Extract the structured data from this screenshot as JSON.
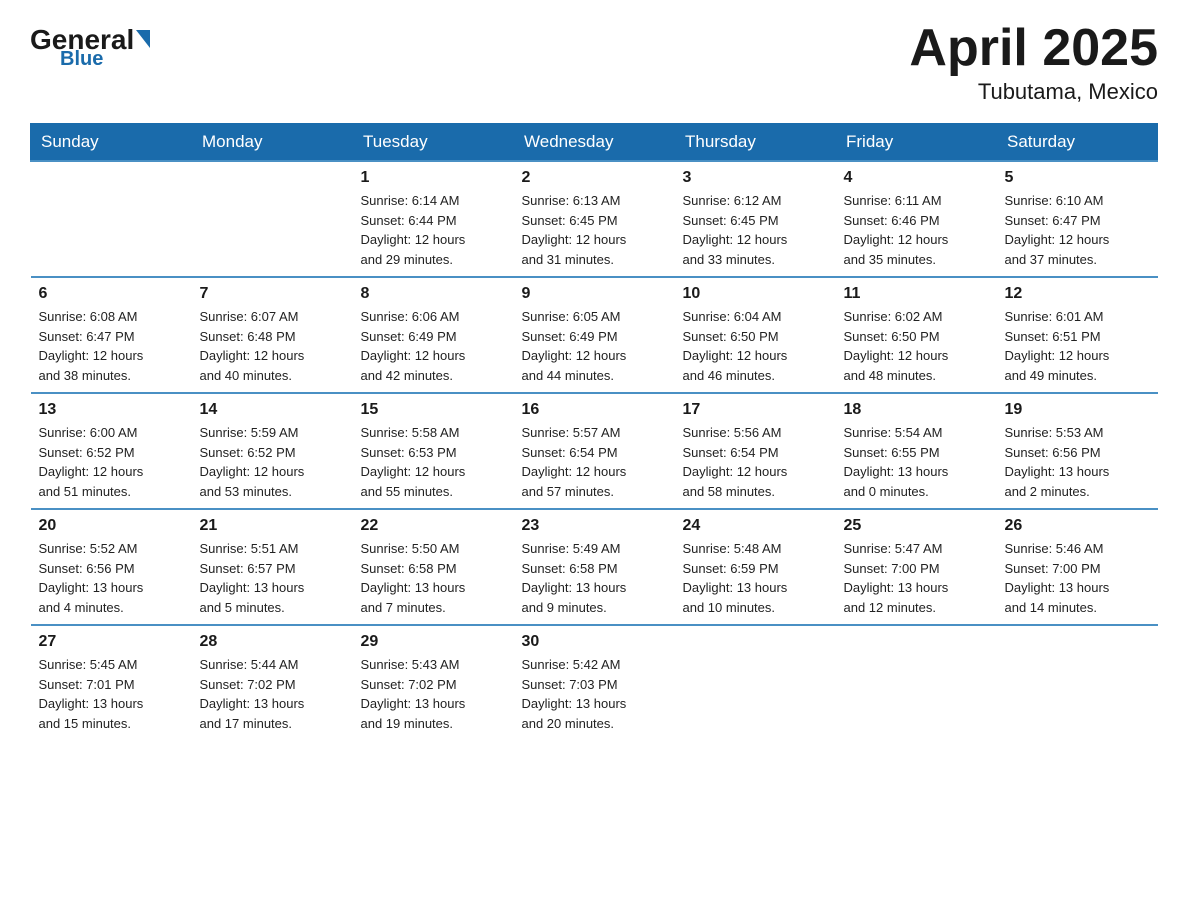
{
  "header": {
    "logo_general": "General",
    "logo_blue": "Blue",
    "month_year": "April 2025",
    "location": "Tubutama, Mexico"
  },
  "days_of_week": [
    "Sunday",
    "Monday",
    "Tuesday",
    "Wednesday",
    "Thursday",
    "Friday",
    "Saturday"
  ],
  "weeks": [
    [
      {
        "day": "",
        "info": ""
      },
      {
        "day": "",
        "info": ""
      },
      {
        "day": "1",
        "info": "Sunrise: 6:14 AM\nSunset: 6:44 PM\nDaylight: 12 hours\nand 29 minutes."
      },
      {
        "day": "2",
        "info": "Sunrise: 6:13 AM\nSunset: 6:45 PM\nDaylight: 12 hours\nand 31 minutes."
      },
      {
        "day": "3",
        "info": "Sunrise: 6:12 AM\nSunset: 6:45 PM\nDaylight: 12 hours\nand 33 minutes."
      },
      {
        "day": "4",
        "info": "Sunrise: 6:11 AM\nSunset: 6:46 PM\nDaylight: 12 hours\nand 35 minutes."
      },
      {
        "day": "5",
        "info": "Sunrise: 6:10 AM\nSunset: 6:47 PM\nDaylight: 12 hours\nand 37 minutes."
      }
    ],
    [
      {
        "day": "6",
        "info": "Sunrise: 6:08 AM\nSunset: 6:47 PM\nDaylight: 12 hours\nand 38 minutes."
      },
      {
        "day": "7",
        "info": "Sunrise: 6:07 AM\nSunset: 6:48 PM\nDaylight: 12 hours\nand 40 minutes."
      },
      {
        "day": "8",
        "info": "Sunrise: 6:06 AM\nSunset: 6:49 PM\nDaylight: 12 hours\nand 42 minutes."
      },
      {
        "day": "9",
        "info": "Sunrise: 6:05 AM\nSunset: 6:49 PM\nDaylight: 12 hours\nand 44 minutes."
      },
      {
        "day": "10",
        "info": "Sunrise: 6:04 AM\nSunset: 6:50 PM\nDaylight: 12 hours\nand 46 minutes."
      },
      {
        "day": "11",
        "info": "Sunrise: 6:02 AM\nSunset: 6:50 PM\nDaylight: 12 hours\nand 48 minutes."
      },
      {
        "day": "12",
        "info": "Sunrise: 6:01 AM\nSunset: 6:51 PM\nDaylight: 12 hours\nand 49 minutes."
      }
    ],
    [
      {
        "day": "13",
        "info": "Sunrise: 6:00 AM\nSunset: 6:52 PM\nDaylight: 12 hours\nand 51 minutes."
      },
      {
        "day": "14",
        "info": "Sunrise: 5:59 AM\nSunset: 6:52 PM\nDaylight: 12 hours\nand 53 minutes."
      },
      {
        "day": "15",
        "info": "Sunrise: 5:58 AM\nSunset: 6:53 PM\nDaylight: 12 hours\nand 55 minutes."
      },
      {
        "day": "16",
        "info": "Sunrise: 5:57 AM\nSunset: 6:54 PM\nDaylight: 12 hours\nand 57 minutes."
      },
      {
        "day": "17",
        "info": "Sunrise: 5:56 AM\nSunset: 6:54 PM\nDaylight: 12 hours\nand 58 minutes."
      },
      {
        "day": "18",
        "info": "Sunrise: 5:54 AM\nSunset: 6:55 PM\nDaylight: 13 hours\nand 0 minutes."
      },
      {
        "day": "19",
        "info": "Sunrise: 5:53 AM\nSunset: 6:56 PM\nDaylight: 13 hours\nand 2 minutes."
      }
    ],
    [
      {
        "day": "20",
        "info": "Sunrise: 5:52 AM\nSunset: 6:56 PM\nDaylight: 13 hours\nand 4 minutes."
      },
      {
        "day": "21",
        "info": "Sunrise: 5:51 AM\nSunset: 6:57 PM\nDaylight: 13 hours\nand 5 minutes."
      },
      {
        "day": "22",
        "info": "Sunrise: 5:50 AM\nSunset: 6:58 PM\nDaylight: 13 hours\nand 7 minutes."
      },
      {
        "day": "23",
        "info": "Sunrise: 5:49 AM\nSunset: 6:58 PM\nDaylight: 13 hours\nand 9 minutes."
      },
      {
        "day": "24",
        "info": "Sunrise: 5:48 AM\nSunset: 6:59 PM\nDaylight: 13 hours\nand 10 minutes."
      },
      {
        "day": "25",
        "info": "Sunrise: 5:47 AM\nSunset: 7:00 PM\nDaylight: 13 hours\nand 12 minutes."
      },
      {
        "day": "26",
        "info": "Sunrise: 5:46 AM\nSunset: 7:00 PM\nDaylight: 13 hours\nand 14 minutes."
      }
    ],
    [
      {
        "day": "27",
        "info": "Sunrise: 5:45 AM\nSunset: 7:01 PM\nDaylight: 13 hours\nand 15 minutes."
      },
      {
        "day": "28",
        "info": "Sunrise: 5:44 AM\nSunset: 7:02 PM\nDaylight: 13 hours\nand 17 minutes."
      },
      {
        "day": "29",
        "info": "Sunrise: 5:43 AM\nSunset: 7:02 PM\nDaylight: 13 hours\nand 19 minutes."
      },
      {
        "day": "30",
        "info": "Sunrise: 5:42 AM\nSunset: 7:03 PM\nDaylight: 13 hours\nand 20 minutes."
      },
      {
        "day": "",
        "info": ""
      },
      {
        "day": "",
        "info": ""
      },
      {
        "day": "",
        "info": ""
      }
    ]
  ]
}
